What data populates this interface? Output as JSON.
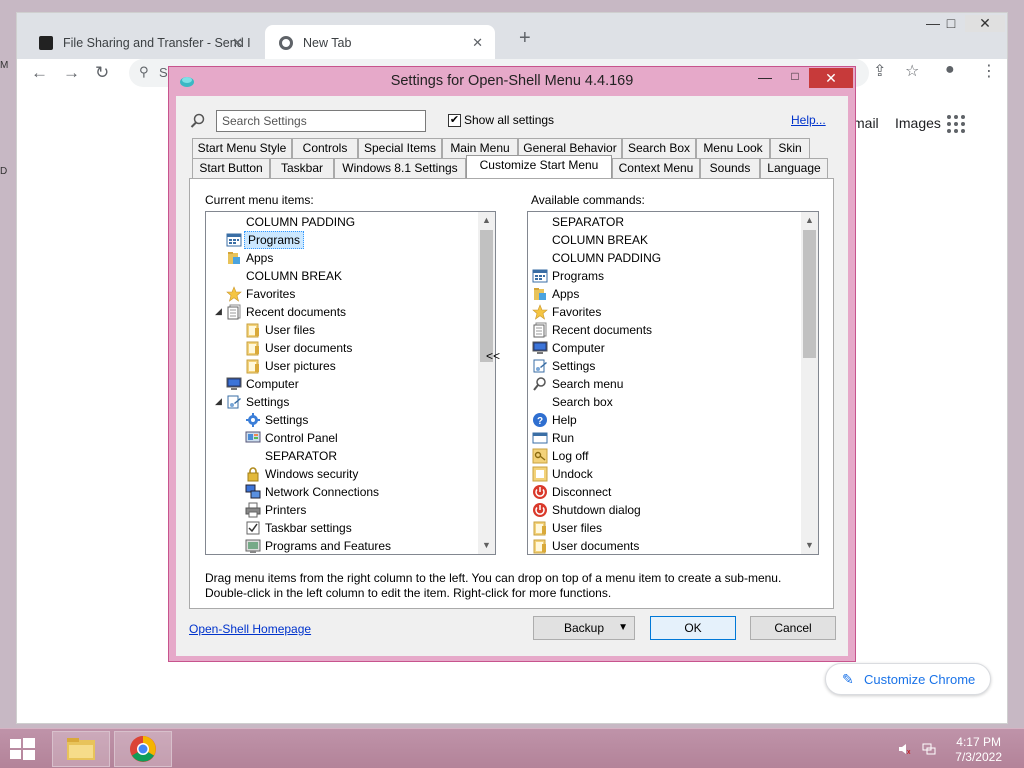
{
  "browser": {
    "tabs": [
      {
        "title": "File Sharing and Transfer - Send I"
      },
      {
        "title": "New Tab"
      }
    ],
    "new_tab_label": "+",
    "address_prefix": "S",
    "gmail_label": "mail",
    "images_label": "Images",
    "customize_label": "Customize Chrome",
    "win_min": "—",
    "win_max": "□",
    "win_close": "✕"
  },
  "dialog": {
    "title": "Settings for Open-Shell Menu 4.4.169",
    "min": "—",
    "max": "□",
    "close": "✕",
    "search_placeholder": "Search Settings",
    "show_all_label": "Show all settings",
    "show_all_checked": true,
    "help_label": "Help...",
    "tabs_row1": [
      "Start Menu Style",
      "Controls",
      "Special Items",
      "Main Menu",
      "General Behavior",
      "Search Box",
      "Menu Look",
      "Skin"
    ],
    "tabs_row2": [
      "Start Button",
      "Taskbar",
      "Windows 8.1 Settings",
      "Customize Start Menu",
      "Context Menu",
      "Sounds",
      "Language"
    ],
    "selected_tab": "Customize Start Menu",
    "current_label": "Current menu items:",
    "available_label": "Available commands:",
    "current_items": [
      {
        "label": "COLUMN PADDING",
        "icon": "none-icon"
      },
      {
        "label": "Programs",
        "icon": "programs-icon"
      },
      {
        "label": "Apps",
        "icon": "apps-icon"
      },
      {
        "label": "COLUMN BREAK",
        "icon": "none-icon"
      },
      {
        "label": "Favorites",
        "icon": "star-icon"
      },
      {
        "label": "Recent documents",
        "icon": "recent-documents-icon"
      },
      {
        "label": "User files",
        "icon": "folder-icon"
      },
      {
        "label": "User documents",
        "icon": "folder-icon"
      },
      {
        "label": "User pictures",
        "icon": "folder-icon"
      },
      {
        "label": "Computer",
        "icon": "computer-icon"
      },
      {
        "label": "Settings",
        "icon": "settings-icon"
      },
      {
        "label": "Settings",
        "icon": "gear-icon"
      },
      {
        "label": "Control Panel",
        "icon": "control-panel-icon"
      },
      {
        "label": "SEPARATOR",
        "icon": "none-icon"
      },
      {
        "label": "Windows security",
        "icon": "lock-icon"
      },
      {
        "label": "Network Connections",
        "icon": "network-icon"
      },
      {
        "label": "Printers",
        "icon": "printer-icon"
      },
      {
        "label": "Taskbar settings",
        "icon": "checklist-icon"
      },
      {
        "label": "Programs and Features",
        "icon": "programs-features-icon"
      }
    ],
    "move_left_label": "<<",
    "available_items": [
      {
        "label": "SEPARATOR",
        "icon": "none-icon"
      },
      {
        "label": "COLUMN BREAK",
        "icon": "none-icon"
      },
      {
        "label": "COLUMN PADDING",
        "icon": "none-icon"
      },
      {
        "label": "Programs",
        "icon": "programs-icon"
      },
      {
        "label": "Apps",
        "icon": "apps-icon"
      },
      {
        "label": "Favorites",
        "icon": "star-icon"
      },
      {
        "label": "Recent documents",
        "icon": "recent-documents-icon"
      },
      {
        "label": "Computer",
        "icon": "computer-icon"
      },
      {
        "label": "Settings",
        "icon": "settings-icon"
      },
      {
        "label": "Search menu",
        "icon": "search-icon"
      },
      {
        "label": "Search box",
        "icon": "none-icon"
      },
      {
        "label": "Help",
        "icon": "help-icon"
      },
      {
        "label": "Run",
        "icon": "run-icon"
      },
      {
        "label": "Log off",
        "icon": "key-icon"
      },
      {
        "label": "Undock",
        "icon": "undock-icon"
      },
      {
        "label": "Disconnect",
        "icon": "power-icon"
      },
      {
        "label": "Shutdown dialog",
        "icon": "power-icon"
      },
      {
        "label": "User files",
        "icon": "folder-icon"
      },
      {
        "label": "User documents",
        "icon": "folder-icon"
      }
    ],
    "hint_line1": "Drag menu items from the right column to the left. You can drop on top of a menu item to create a sub-menu.",
    "hint_line2": "Double-click in the left column to edit the item. Right-click for more functions.",
    "homepage_label": "Open-Shell Homepage",
    "backup_label": "Backup",
    "ok_label": "OK",
    "cancel_label": "Cancel"
  },
  "taskbar": {
    "time": "4:17 PM",
    "date": "7/3/2022"
  }
}
